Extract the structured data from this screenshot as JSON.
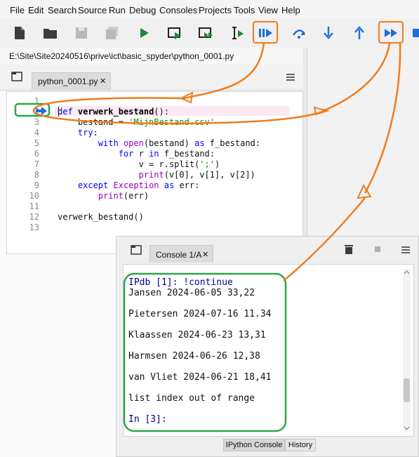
{
  "menu": [
    "File",
    "Edit",
    "Search",
    "Source",
    "Run",
    "Debug",
    "Consoles",
    "Projects",
    "Tools",
    "View",
    "Help"
  ],
  "path": "E:\\Site\\Site20240516\\prive\\ict\\basic_spyder\\python_0001.py",
  "editor_tab": {
    "label": "python_0001.py",
    "close": "✕"
  },
  "code": {
    "line_numbers": [
      "1",
      "2",
      "3",
      "4",
      "5",
      "6",
      "7",
      "8",
      "9",
      "10",
      "11",
      "12",
      "13"
    ],
    "current_line": "2",
    "l2": [
      "def",
      "verwerk_bestand",
      "():"
    ],
    "l3": [
      "bestand = ",
      "'MijnBestand.csv'"
    ],
    "l4": [
      "try",
      ":"
    ],
    "l5": [
      "with",
      "open",
      "(bestand) ",
      "as",
      " f_bestand:"
    ],
    "l6": [
      "for",
      " r ",
      "in",
      " f_bestand:"
    ],
    "l7": [
      "v = r.split(",
      "';'",
      ")"
    ],
    "l8": [
      "print",
      "(v[0], v[1], v[2])"
    ],
    "l9": [
      "except",
      "Exception",
      "as",
      " err:"
    ],
    "l10": [
      "print",
      "(err)"
    ],
    "l12": "verwerk_bestand()"
  },
  "console": {
    "tab_label": "Console 1/A",
    "tab_close": "✕",
    "lines": [
      {
        "prompt": "IPdb [1]: ",
        "text": "!continue"
      },
      {
        "text": "Jansen 2024-06-05 33,22"
      },
      {
        "text": "Pietersen 2024-07-16 11.34"
      },
      {
        "text": "Klaassen 2024-06-23 13,31"
      },
      {
        "text": "Harmsen 2024-06-26 12,38"
      },
      {
        "text": "van Vliet 2024-06-21 18,41"
      },
      {
        "text": "list index out of range"
      },
      {
        "prompt": "In [3]:"
      }
    ],
    "bottom_tabs": [
      "IPython Console",
      "History"
    ]
  },
  "colors": {
    "toolbar_blue": "#1e6fd9",
    "toolbar_green": "#1a8a3a",
    "annotation_orange": "#f07c1c",
    "annotation_green": "#2aa848"
  }
}
